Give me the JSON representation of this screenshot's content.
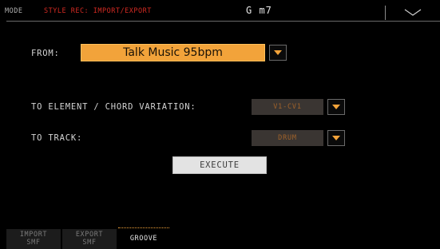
{
  "header": {
    "mode_label": "MODE",
    "page_title": "STYLE REC: IMPORT/EXPORT",
    "chord": "G m7",
    "menu_icon": "chevron-down-icon"
  },
  "from": {
    "label": "FROM:",
    "value": "Talk Music 95bpm"
  },
  "to_element": {
    "label": "TO ELEMENT / CHORD VARIATION:",
    "value": "V1-CV1"
  },
  "to_track": {
    "label": "TO TRACK:",
    "value": "DRUM"
  },
  "execute_label": "EXECUTE",
  "tabs": [
    {
      "line1": "IMPORT",
      "line2": "SMF",
      "active": false
    },
    {
      "line1": "EXPORT",
      "line2": "SMF",
      "active": false
    },
    {
      "line1": "GROOVE",
      "line2": "",
      "active": true
    }
  ],
  "colors": {
    "accent": "#f2a33a",
    "title_red": "#d32a22",
    "background": "#000000"
  }
}
